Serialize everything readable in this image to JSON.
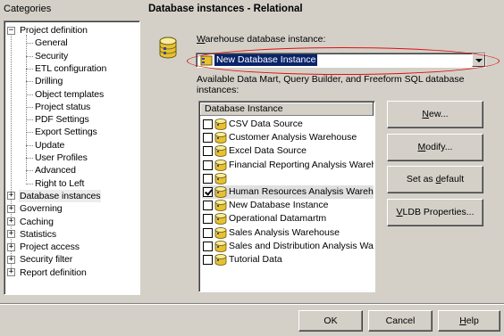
{
  "left_panel": {
    "title": "Categories",
    "tree": [
      {
        "label": "Project definition",
        "expanded": true,
        "level": 0
      },
      {
        "label": "General",
        "level": 1
      },
      {
        "label": "Security",
        "level": 1
      },
      {
        "label": "ETL configuration",
        "level": 1
      },
      {
        "label": "Drilling",
        "level": 1
      },
      {
        "label": "Object templates",
        "level": 1
      },
      {
        "label": "Project status",
        "level": 1
      },
      {
        "label": "PDF Settings",
        "level": 1
      },
      {
        "label": "Export Settings",
        "level": 1
      },
      {
        "label": "Update",
        "level": 1
      },
      {
        "label": "User Profiles",
        "level": 1
      },
      {
        "label": "Advanced",
        "level": 1
      },
      {
        "label": "Right to Left",
        "level": 1
      },
      {
        "label": "Database instances",
        "expanded": false,
        "level": 0,
        "selected": true
      },
      {
        "label": "Governing",
        "expanded": false,
        "level": 0
      },
      {
        "label": "Caching",
        "expanded": false,
        "level": 0
      },
      {
        "label": "Statistics",
        "expanded": false,
        "level": 0
      },
      {
        "label": "Project access",
        "expanded": false,
        "level": 0
      },
      {
        "label": "Security filter",
        "expanded": false,
        "level": 0
      },
      {
        "label": "Report definition",
        "expanded": false,
        "level": 0
      }
    ]
  },
  "main": {
    "title": "Database instances - Relational",
    "warehouse_label_prefix": "W",
    "warehouse_label_rest": "arehouse database instance:",
    "warehouse_value": "New Database Instance",
    "available_label": "Available Data Mart, Query Builder, and Freeform SQL database instances:",
    "list_header": "Database Instance",
    "instances": [
      {
        "label": "CSV Data Source",
        "checked": false
      },
      {
        "label": "Customer Analysis Warehouse",
        "checked": false
      },
      {
        "label": "Excel Data Source",
        "checked": false
      },
      {
        "label": "Financial Reporting Analysis Wareh...",
        "checked": false
      },
      {
        "label": "",
        "checked": false
      },
      {
        "label": "Human Resources Analysis Wareho...",
        "checked": true,
        "selected": true
      },
      {
        "label": "New Database Instance",
        "checked": false
      },
      {
        "label": "Operational Datamartm",
        "checked": false
      },
      {
        "label": "Sales Analysis Warehouse",
        "checked": false
      },
      {
        "label": "Sales and Distribution Analysis War...",
        "checked": false
      },
      {
        "label": "Tutorial Data",
        "checked": false
      }
    ],
    "buttons": {
      "new": {
        "pre": "",
        "u": "N",
        "post": "ew..."
      },
      "modify": {
        "pre": "",
        "u": "M",
        "post": "odify..."
      },
      "set_default": {
        "pre": "Set as ",
        "u": "d",
        "post": "efault"
      },
      "vldb": {
        "pre": "",
        "u": "V",
        "post": "LDB Properties..."
      }
    }
  },
  "footer": {
    "ok": "OK",
    "cancel": "Cancel",
    "help_u": "H",
    "help_rest": "elp"
  },
  "colors": {
    "window_bg": "#d4d0c8",
    "selection": "#0a246a",
    "highlight_oval": "#e01010"
  }
}
